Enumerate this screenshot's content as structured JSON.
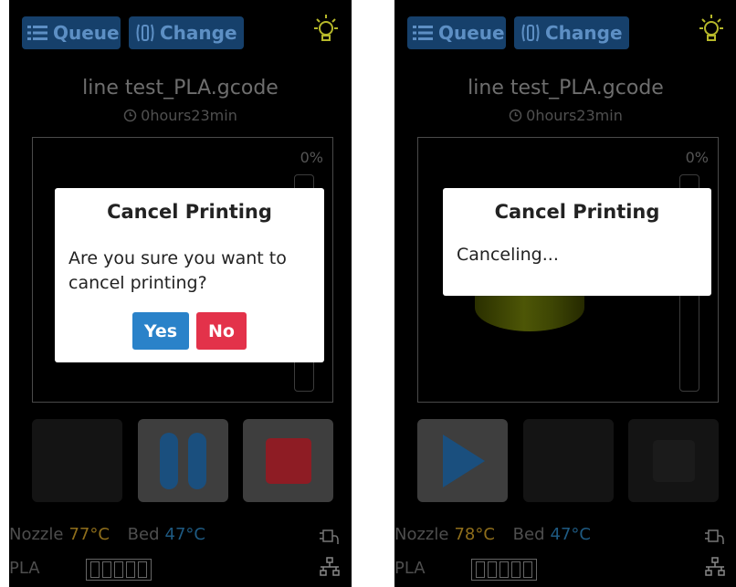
{
  "screens": {
    "left": {
      "header": {
        "queue_label": "Queue",
        "change_label": "Change"
      },
      "job": {
        "file_name": "line test_PLA.gcode",
        "eta": "0hours23min",
        "progress": "0%"
      },
      "status": {
        "nozzle_label": "Nozzle",
        "nozzle_temp": "77°C",
        "bed_label": "Bed",
        "bed_temp": "47°C",
        "material": "PLA"
      },
      "dialog": {
        "title": "Cancel Printing",
        "message": "Are you sure you want to cancel printing?",
        "yes_label": "Yes",
        "no_label": "No"
      }
    },
    "right": {
      "header": {
        "queue_label": "Queue",
        "change_label": "Change"
      },
      "job": {
        "file_name": "line test_PLA.gcode",
        "eta": "0hours23min",
        "progress": "0%"
      },
      "status": {
        "nozzle_label": "Nozzle",
        "nozzle_temp": "78°C",
        "bed_label": "Bed",
        "bed_temp": "47°C",
        "material": "PLA"
      },
      "dialog": {
        "title": "Cancel Printing",
        "message": "Canceling..."
      }
    }
  },
  "colors": {
    "background": "#000000",
    "header_button": "#16406b",
    "yes_button": "#2a82c9",
    "no_button": "#e3324a",
    "nozzle_temp": "#8f6e1b",
    "bed_temp": "#1e5a82",
    "bulb": "#b6b82a",
    "pause_icon": "#1a4f7e",
    "stop_icon": "#8e1c24",
    "play_icon": "#1a4f7e"
  },
  "icons": [
    "list-icon",
    "filament-icon",
    "bulb-icon",
    "clock-icon",
    "pause-icon",
    "stop-icon",
    "play-icon",
    "plug-icon",
    "network-icon"
  ]
}
